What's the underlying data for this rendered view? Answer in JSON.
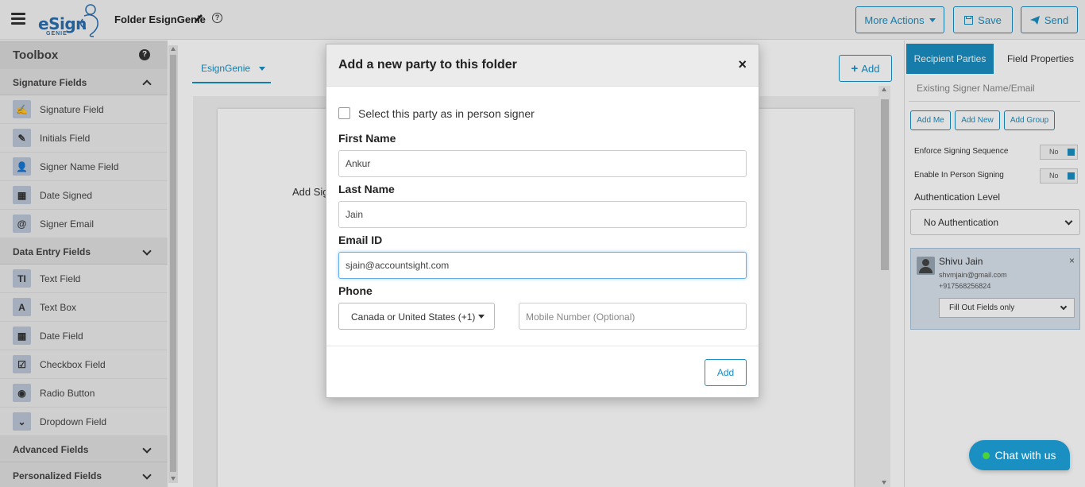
{
  "header": {
    "logo_text": "eSign",
    "logo_sub": "GENIE",
    "folder_title": "Folder EsignGenie",
    "help_icon": "?",
    "more_actions": "More Actions",
    "save": "Save",
    "send": "Send"
  },
  "toolbox": {
    "title": "Toolbox",
    "help_icon": "?",
    "sections": [
      {
        "title": "Signature Fields",
        "items": [
          {
            "label": "Signature Field",
            "icon": "signature-icon",
            "glyph": "✍"
          },
          {
            "label": "Initials Field",
            "icon": "pencil-icon",
            "glyph": "✎"
          },
          {
            "label": "Signer Name Field",
            "icon": "user-icon",
            "glyph": "👤"
          },
          {
            "label": "Date Signed",
            "icon": "calendar-icon",
            "glyph": "▦"
          },
          {
            "label": "Signer Email",
            "icon": "at-icon",
            "glyph": "@"
          }
        ]
      },
      {
        "title": "Data Entry Fields",
        "items": [
          {
            "label": "Text Field",
            "icon": "text-field-icon",
            "glyph": "TI"
          },
          {
            "label": "Text Box",
            "icon": "text-box-icon",
            "glyph": "A"
          },
          {
            "label": "Date Field",
            "icon": "calendar-icon",
            "glyph": "▦"
          },
          {
            "label": "Checkbox Field",
            "icon": "checkbox-icon",
            "glyph": "☑"
          },
          {
            "label": "Radio Button",
            "icon": "radio-icon",
            "glyph": "◉"
          },
          {
            "label": "Dropdown Field",
            "icon": "dropdown-icon",
            "glyph": "⌄"
          }
        ]
      },
      {
        "title": "Advanced Fields"
      },
      {
        "title": "Personalized Fields"
      }
    ]
  },
  "canvas": {
    "tab": "EsignGenie",
    "add_button": "Add",
    "page_text": "Add Sig"
  },
  "right_panel": {
    "tabs": [
      "Recipient Parties",
      "Field Properties"
    ],
    "search_placeholder": "Existing Signer Name/Email",
    "buttons": [
      "Add Me",
      "Add New",
      "Add Group"
    ],
    "enforce_sequence": "Enforce Signing Sequence",
    "enforce_value": "No",
    "in_person": "Enable In Person Signing",
    "in_person_value": "No",
    "auth_label": "Authentication Level",
    "auth_value": "No Authentication",
    "party": {
      "name": "Shivu Jain",
      "email": "shvmjain@gmail.com",
      "phone": "+917568256824",
      "role": "Fill Out Fields only",
      "close": "×"
    }
  },
  "chat": {
    "label": "Chat with us"
  },
  "modal": {
    "title": "Add a new party to this folder",
    "close": "×",
    "in_person_label": "Select this party as in person signer",
    "first_name_label": "First Name",
    "first_name_value": "Ankur",
    "last_name_label": "Last Name",
    "last_name_value": "Jain",
    "email_label": "Email ID",
    "email_value": "sjain@accountsight.com",
    "phone_label": "Phone",
    "country_value": "Canada or United States (+1)",
    "mobile_placeholder": "Mobile Number (Optional)",
    "add_button": "Add"
  }
}
